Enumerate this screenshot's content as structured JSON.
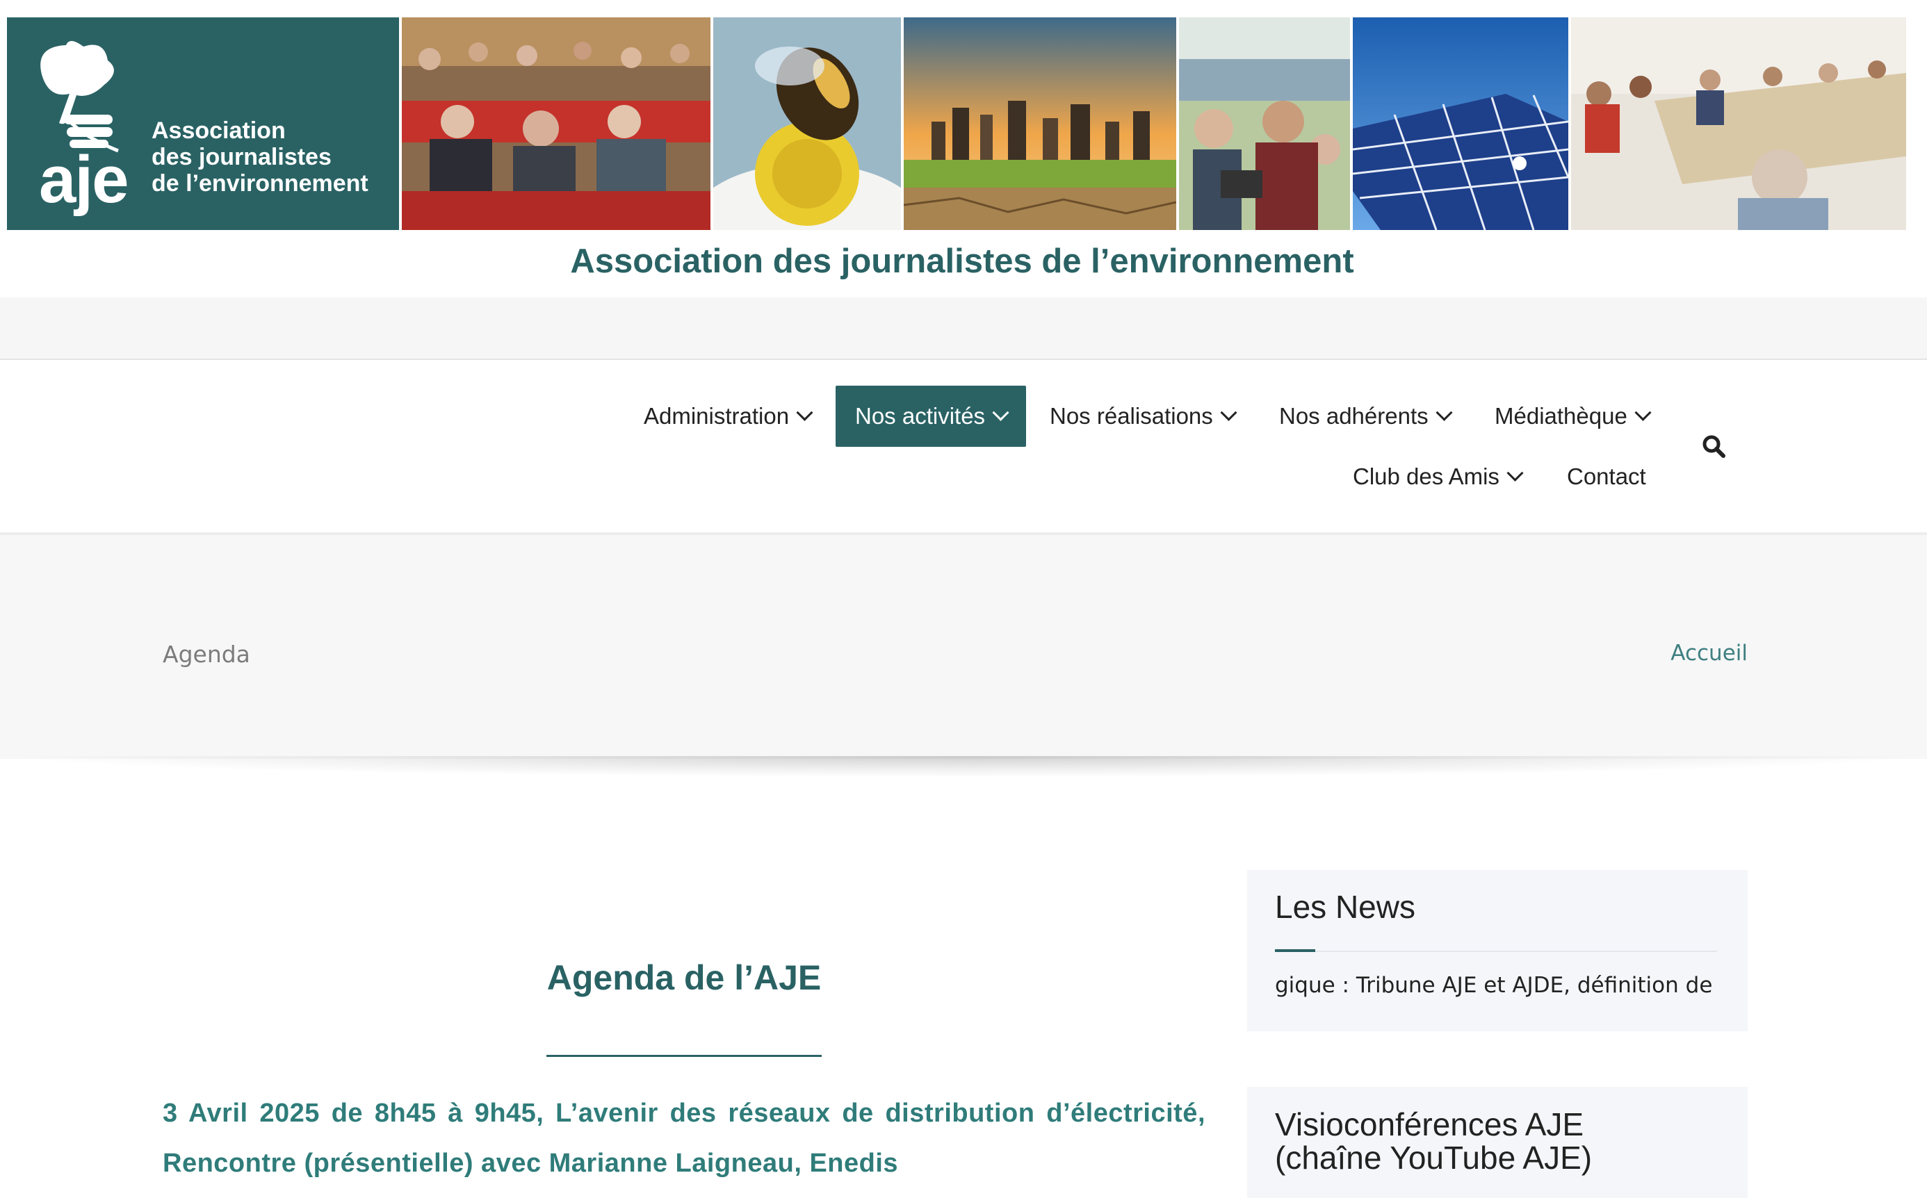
{
  "banner": {
    "logo_mark": "aje",
    "logo_lines": [
      "Association",
      "des journalistes",
      "de l’environnement"
    ],
    "title": "Association des journalistes de l’environnement"
  },
  "nav": {
    "row1": [
      {
        "label": "Administration",
        "has_dropdown": true,
        "active": false
      },
      {
        "label": "Nos activités",
        "has_dropdown": true,
        "active": true
      },
      {
        "label": "Nos réalisations",
        "has_dropdown": true,
        "active": false
      },
      {
        "label": "Nos adhérents",
        "has_dropdown": true,
        "active": false
      },
      {
        "label": "Médiathèque",
        "has_dropdown": true,
        "active": false
      }
    ],
    "row2": [
      {
        "label": "Club des Amis",
        "has_dropdown": true,
        "active": false
      },
      {
        "label": "Contact",
        "has_dropdown": false,
        "active": false
      }
    ],
    "search_icon": "search-icon"
  },
  "page_header": {
    "title": "Agenda",
    "breadcrumb_home": "Accueil"
  },
  "article": {
    "title": "Agenda de l’AJE",
    "event_text": "3 Avril 2025 de 8h45 à 9h45, L’avenir des réseaux de distribution d’électricité, Rencontre (présentielle) avec Marianne Laigneau, Enedis"
  },
  "sidebar": {
    "news": {
      "title": "Les News",
      "ticker_text": "gique : Tribune AJE et AJDE, définition de la n"
    },
    "video": {
      "title": "Visioconférences AJE (chaîne YouTube AJE)"
    }
  },
  "colors": {
    "brand": "#2a6264",
    "link": "#3f7f81",
    "event_text": "#2f7c7a"
  }
}
